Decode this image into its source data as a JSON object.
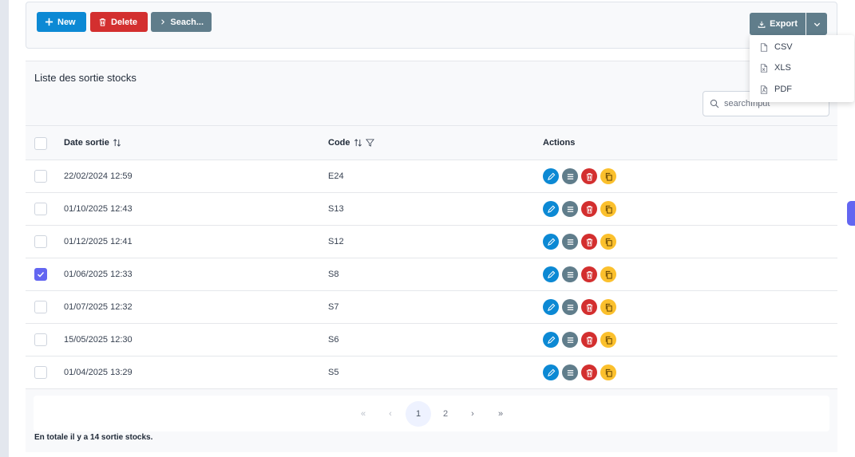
{
  "toolbar": {
    "new_label": "New",
    "delete_label": "Delete",
    "search_label": "Seach...",
    "export_label": "Export"
  },
  "export_menu": {
    "items": [
      {
        "label": "CSV",
        "icon": "file-icon"
      },
      {
        "label": "XLS",
        "icon": "file-excel-icon"
      },
      {
        "label": "PDF",
        "icon": "file-pdf-icon"
      }
    ]
  },
  "card": {
    "title": "Liste des sortie stocks",
    "search_placeholder": "searchInput"
  },
  "table": {
    "columns": [
      {
        "label": "Date sortie"
      },
      {
        "label": "Code"
      },
      {
        "label": "Actions"
      }
    ],
    "rows": [
      {
        "date": "22/02/2024 12:59",
        "code": "E24",
        "selected": false
      },
      {
        "date": "01/10/2025 12:43",
        "code": "S13",
        "selected": false
      },
      {
        "date": "01/12/2025 12:41",
        "code": "S12",
        "selected": false
      },
      {
        "date": "01/06/2025 12:33",
        "code": "S8",
        "selected": true
      },
      {
        "date": "01/07/2025 12:32",
        "code": "S7",
        "selected": false
      },
      {
        "date": "15/05/2025 12:30",
        "code": "S6",
        "selected": false
      },
      {
        "date": "01/04/2025 13:29",
        "code": "S5",
        "selected": false
      }
    ]
  },
  "pagination": {
    "first": "«",
    "prev": "‹",
    "pages": [
      "1",
      "2"
    ],
    "current": "1",
    "next": "›",
    "last": "»"
  },
  "footer": {
    "total_text": "En totale il y a 14 sortie stocks."
  },
  "colors": {
    "primary": "#0c89d4",
    "danger": "#d32f2f",
    "secondary": "#607d8b",
    "warning": "#fbc02d",
    "accent": "#6366f1"
  }
}
